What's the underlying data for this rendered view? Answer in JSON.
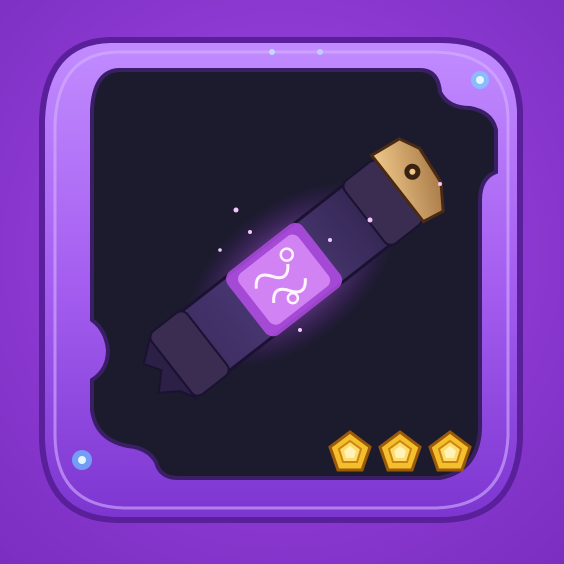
{
  "item_card": {
    "item_icon": "ancient-scroll-icon",
    "frame_style": "epic-purple",
    "colors": {
      "background": "#8c3fd0",
      "frame": "#a35cf0",
      "frame_highlight": "#c99bff",
      "frame_shadow": "#5a1f9a",
      "panel": "#1c1b2e",
      "glow": "#e07bff",
      "gem": "#f2b21c"
    },
    "rarity": {
      "stars": 3,
      "max_stars": 3,
      "gem_icon": "pentagon-gem-icon"
    }
  }
}
